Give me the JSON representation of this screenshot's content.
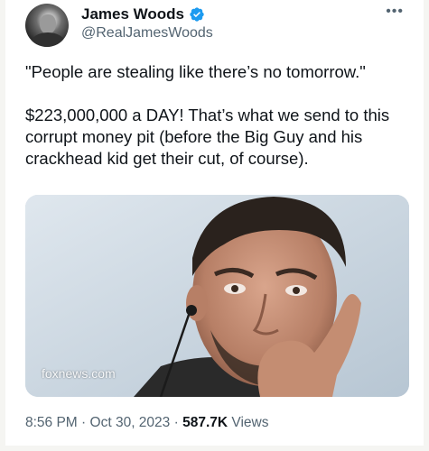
{
  "author": {
    "display_name": "James Woods",
    "handle": "@RealJamesWoods",
    "avatar_icon": "person-avatar",
    "verified_icon": "verified-badge-icon",
    "verified_color": "#1d9bf0"
  },
  "menu": {
    "more_icon": "more-options-icon",
    "glyph": "•••"
  },
  "tweet": {
    "quote": "\"People are stealing like there’s no tomorrow.\"",
    "body": "$223,000,000 a DAY! That’s what we send to this corrupt money pit (before the Big Guy and his crackhead kid get their cut, of course)."
  },
  "media": {
    "watermark": "foxnews.com"
  },
  "meta": {
    "time": "8:56 PM",
    "separator": "·",
    "date": "Oct 30, 2023",
    "views_count": "587.7K",
    "views_label": "Views"
  },
  "colors": {
    "text_primary": "#0f1419",
    "text_secondary": "#536471",
    "background": "#ffffff"
  }
}
